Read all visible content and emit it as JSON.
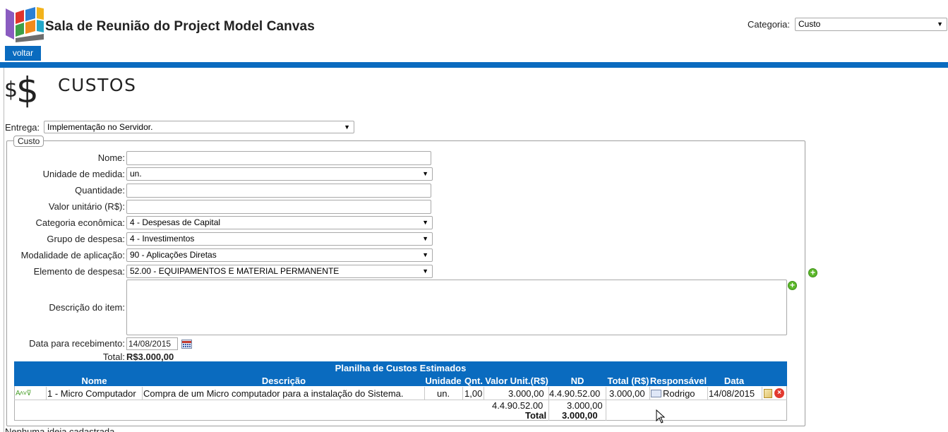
{
  "header": {
    "title": "Sala de Reunião do Project Model Canvas",
    "category_label": "Categoria:",
    "category_value": "Custo",
    "back_label": "voltar"
  },
  "section": {
    "title": "CUSTOS"
  },
  "entrega": {
    "label": "Entrega:",
    "value": "Implementação no Servidor."
  },
  "form": {
    "legend": "Custo",
    "nome_label": "Nome:",
    "nome_value": "",
    "unidade_label": "Unidade de medida:",
    "unidade_value": "un.",
    "quantidade_label": "Quantidade:",
    "quantidade_value": "",
    "valor_label": "Valor unitário (R$):",
    "valor_value": "",
    "categoria_label": "Categoria econômica:",
    "categoria_value": "4 - Despesas de Capital",
    "grupo_label": "Grupo de despesa:",
    "grupo_value": "4 - Investimentos",
    "modalidade_label": "Modalidade de aplicação:",
    "modalidade_value": "90 - Aplicações Diretas",
    "elemento_label": "Elemento de despesa:",
    "elemento_value": "52.00 - EQUIPAMENTOS E MATERIAL PERMANENTE",
    "descricao_label": "Descrição do item:",
    "data_label": "Data para recebimento:",
    "data_value": "14/08/2015",
    "total_label": "Total:",
    "total_value": "R$3.000,00"
  },
  "table": {
    "caption": "Planilha de Custos Estimados",
    "headers": {
      "nome": "Nome",
      "descricao": "Descrição",
      "unidade": "Unidade",
      "qnt": "Qnt.",
      "valor_unit": "Valor Unit.(R$)",
      "nd": "ND",
      "total": "Total (R$)",
      "responsavel": "Responsável",
      "data": "Data"
    },
    "row": {
      "nome": "1 - Micro Computador",
      "descricao": "Compra de um Micro computador para a instalação do Sistema.",
      "unidade": "un.",
      "qnt": "1,00",
      "valor_unit": "3.000,00",
      "nd": "4.4.90.52.00",
      "total": "3.000,00",
      "responsavel": "Rodrigo",
      "data": "14/08/2015"
    },
    "subtotal": {
      "nd": "4.4.90.52.00",
      "value": "3.000,00"
    },
    "total": {
      "label": "Total",
      "value": "3.000,00"
    }
  },
  "footer": {
    "text": "Nenhuma ideia cadastrada"
  },
  "colors": {
    "accent": "#0a6bbf",
    "add": "#5cb82a",
    "delete": "#e23a2f"
  }
}
